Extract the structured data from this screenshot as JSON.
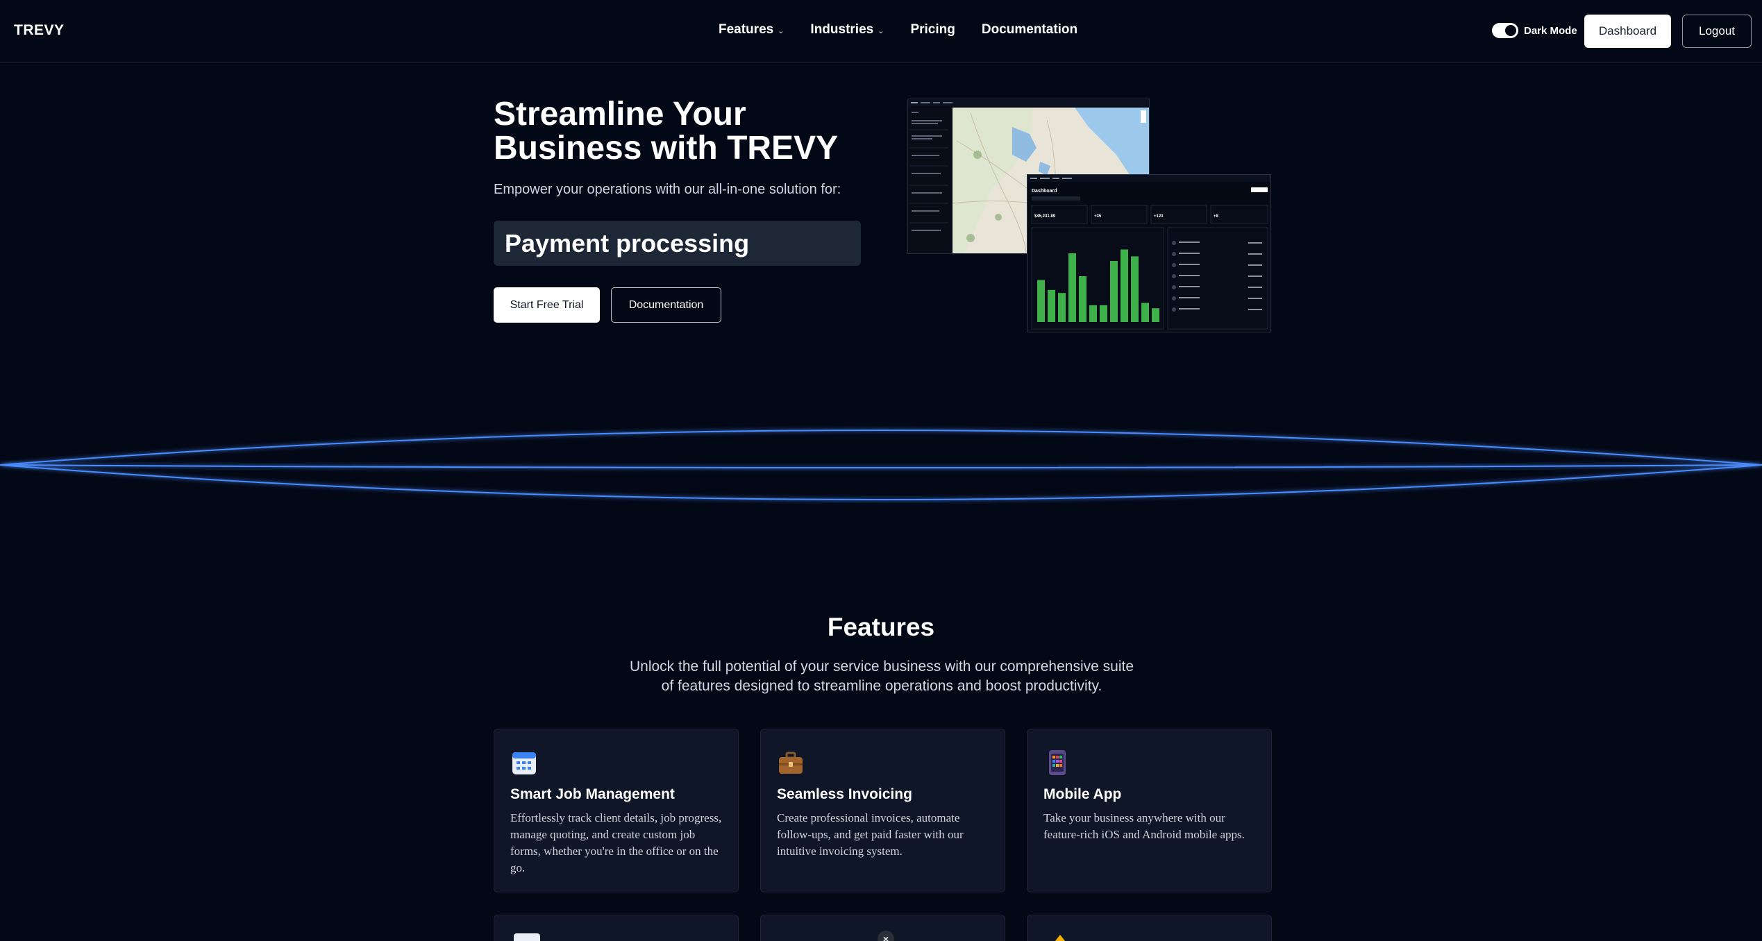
{
  "nav": {
    "logo": "TREVY",
    "links": [
      {
        "label": "Features",
        "has_dropdown": true
      },
      {
        "label": "Industries",
        "has_dropdown": true
      },
      {
        "label": "Pricing",
        "has_dropdown": false
      },
      {
        "label": "Documentation",
        "has_dropdown": false
      }
    ],
    "dark_mode_label": "Dark Mode",
    "dark_mode_on": true,
    "dashboard_label": "Dashboard",
    "logout_label": "Logout"
  },
  "hero": {
    "title_line1": "Streamline Your",
    "title_line2": "Business with TREVY",
    "subtitle": "Empower your operations with our all-in-one solution for:",
    "typing_text": "Payment processing",
    "trial_label": "Start Free Trial",
    "docs_label": "Documentation"
  },
  "mock": {
    "dashboard_title": "Dashboard",
    "revenue_value": "$45,231.89",
    "stat2": "+35",
    "stat3": "+123",
    "stat4": "+8",
    "bars": [
      0.55,
      0.42,
      0.38,
      0.9,
      0.6,
      0.22,
      0.22,
      0.8,
      0.95,
      0.86,
      0.25,
      0.18
    ],
    "bar_color": "#3eb14a"
  },
  "features": {
    "title": "Features",
    "subtitle": "Unlock the full potential of your service business with our comprehensive suite of features designed to streamline operations and boost productivity.",
    "cards": [
      {
        "icon": "calendar-icon",
        "title": "Smart Job Management",
        "desc": "Effortlessly track client details, job progress, manage quoting, and create custom job forms, whether you're in the office or on the go."
      },
      {
        "icon": "briefcase-icon",
        "title": "Seamless Invoicing",
        "desc": "Create professional invoices, automate follow-ups, and get paid faster with our intuitive invoicing system."
      },
      {
        "icon": "mobile-app-icon",
        "title": "Mobile App",
        "desc": "Take your business anywhere with our feature-rich iOS and Android mobile apps."
      }
    ]
  },
  "colors": {
    "background": "#030816",
    "card": "#0e1627",
    "wave": "#4a8cff"
  }
}
